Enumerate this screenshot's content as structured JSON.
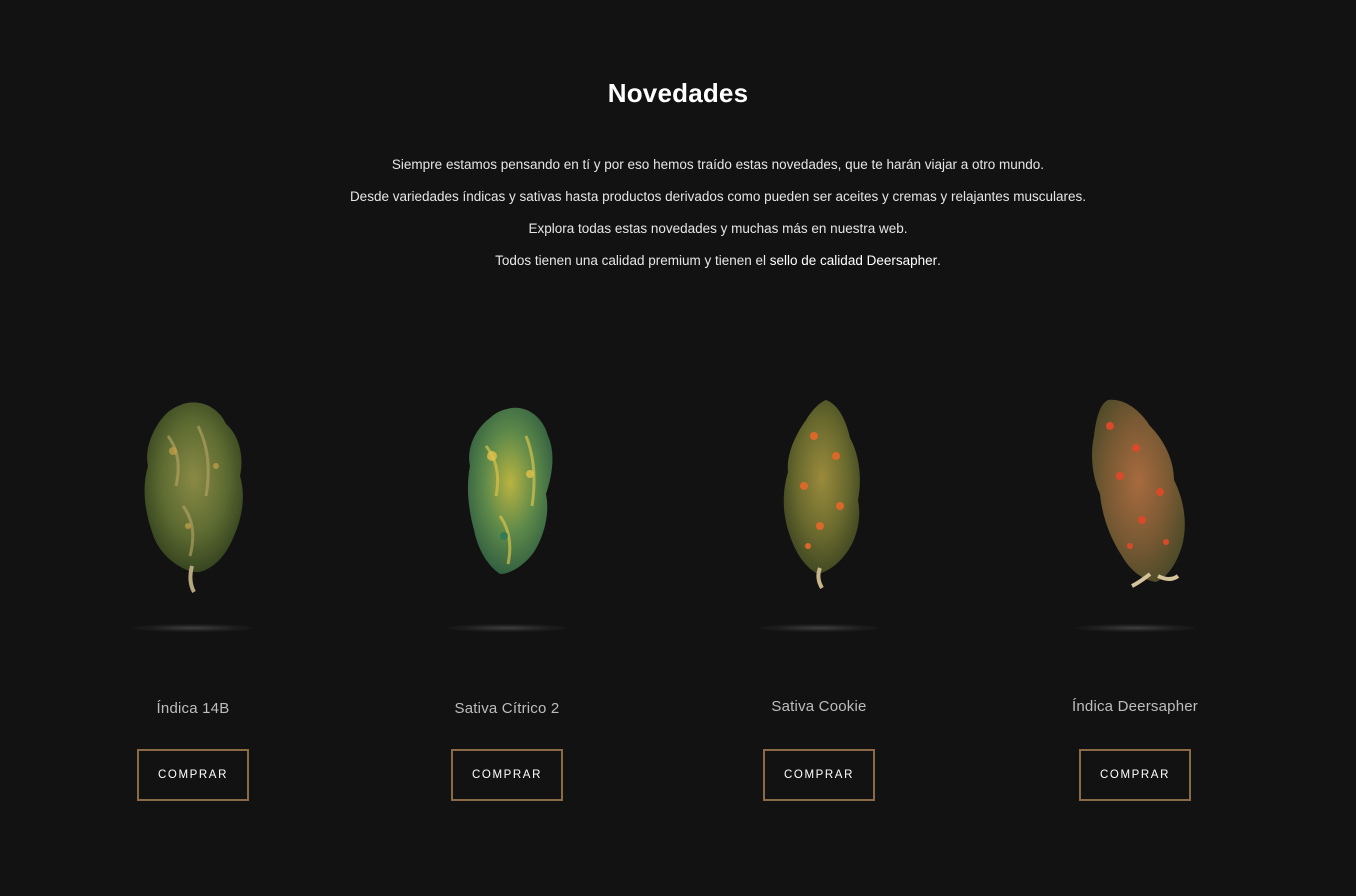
{
  "section": {
    "title": "Novedades",
    "intro_lines": [
      "Siempre estamos pensando en tí y por eso hemos traído estas novedades, que te harán viajar a otro mundo.",
      "Desde variedades índicas y sativas hasta productos derivados como pueden ser aceites y cremas y relajantes musculares.",
      "Explora todas estas novedades y muchas más en nuestra web."
    ],
    "quality_prefix": "Todos tienen una calidad premium y tienen el ",
    "quality_highlight": "sello de calidad Deersapher",
    "quality_suffix": "."
  },
  "colors": {
    "background": "#121212",
    "button_border": "#8a6a46",
    "name_text": "#bdbdbd"
  },
  "products": [
    {
      "name": "Índica 14B",
      "button_label": "COMPRAR",
      "image": "cannabis-bud-green"
    },
    {
      "name": "Sativa Cítrico 2",
      "button_label": "COMPRAR",
      "image": "cannabis-bud-yellow-green"
    },
    {
      "name": "Sativa Cookie",
      "button_label": "COMPRAR",
      "image": "cannabis-bud-orange-hairs"
    },
    {
      "name": "Índica Deersapher",
      "button_label": "COMPRAR",
      "image": "cannabis-bud-red-orange"
    }
  ]
}
